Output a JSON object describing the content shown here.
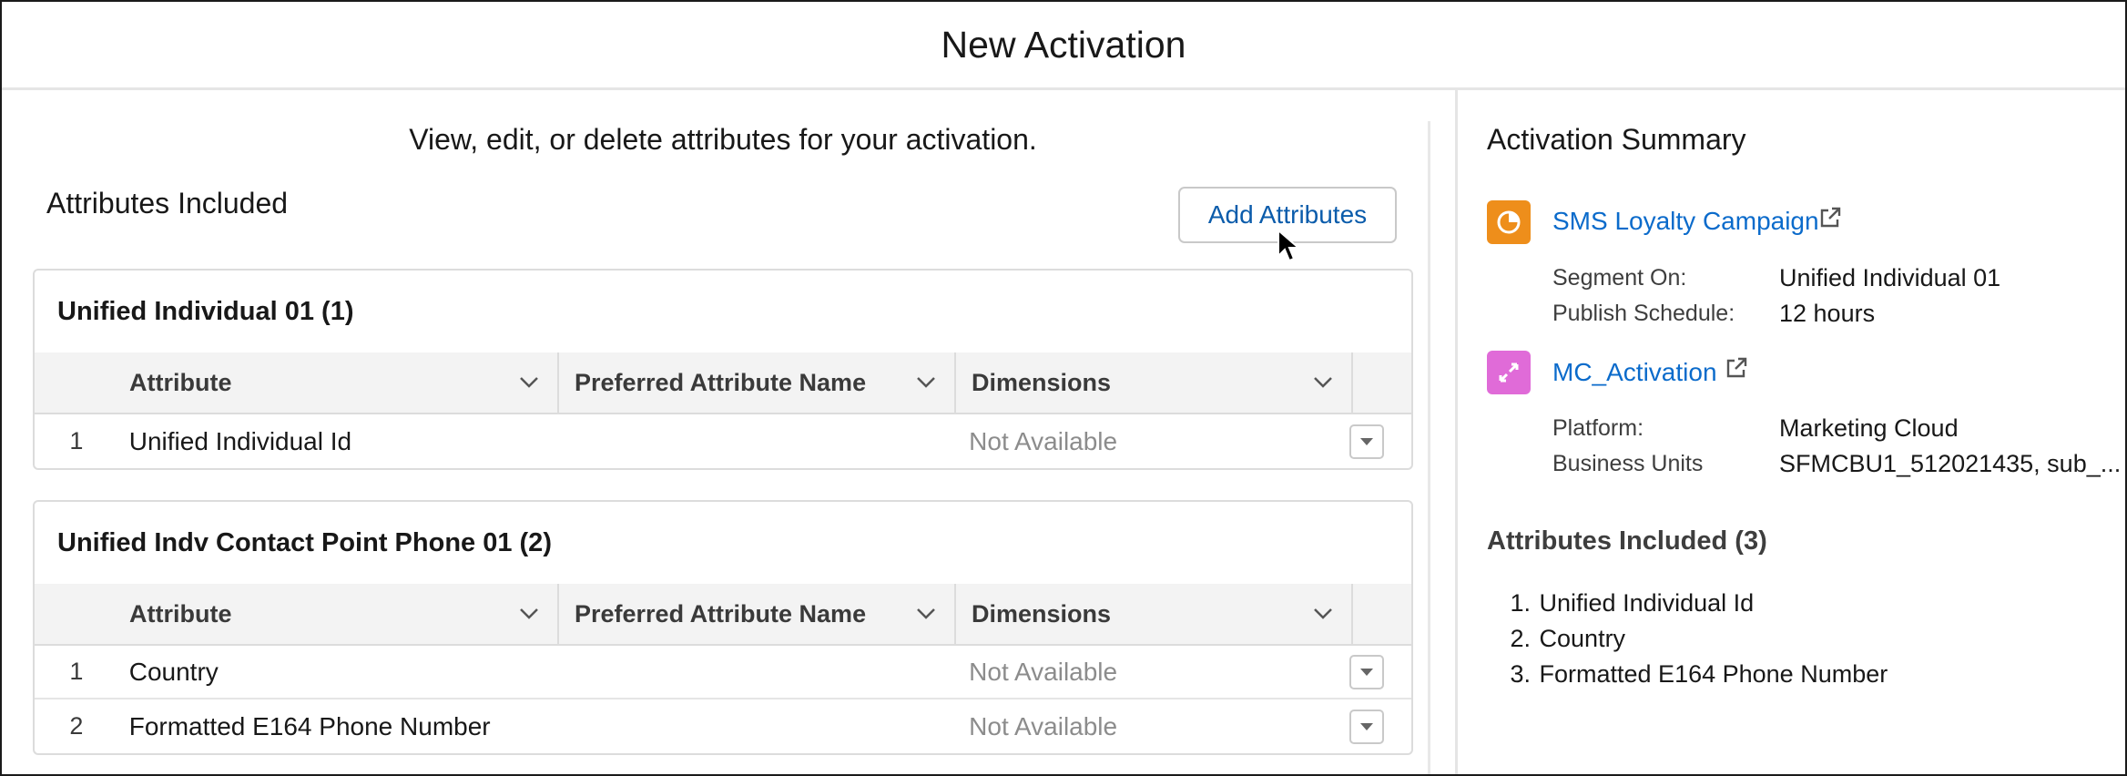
{
  "header": {
    "title": "New Activation"
  },
  "left": {
    "intro": "View, edit, or delete attributes for your activation.",
    "section_title": "Attributes Included",
    "add_button": "Add Attributes",
    "columns": {
      "attribute": "Attribute",
      "preferred": "Preferred Attribute Name",
      "dimensions": "Dimensions"
    },
    "groups": [
      {
        "title": "Unified Individual 01 (1)",
        "rows": [
          {
            "num": "1",
            "attribute": "Unified Individual Id",
            "preferred": "",
            "dimensions": "Not Available"
          }
        ]
      },
      {
        "title": "Unified Indv Contact Point Phone 01 (2)",
        "rows": [
          {
            "num": "1",
            "attribute": "Country",
            "preferred": "",
            "dimensions": "Not Available"
          },
          {
            "num": "2",
            "attribute": "Formatted E164 Phone Number",
            "preferred": "",
            "dimensions": "Not Available"
          }
        ]
      }
    ]
  },
  "summary": {
    "title": "Activation Summary",
    "segment": {
      "name": "SMS Loyalty Campaign",
      "icon": "segment-icon",
      "icon_color": "#ee8e1b",
      "segment_on_label": "Segment On:",
      "segment_on_value": "Unified Individual 01",
      "schedule_label": "Publish Schedule:",
      "schedule_value": "12 hours"
    },
    "target": {
      "name": "MC_Activation",
      "icon": "activation-target-icon",
      "icon_color": "#e06bd8",
      "platform_label": "Platform:",
      "platform_value": "Marketing Cloud",
      "bu_label": "Business Units",
      "bu_value": "SFMCBU1_512021435, sub_..."
    },
    "attributes_heading": "Attributes Included (3)",
    "attributes": [
      {
        "n": "1.",
        "name": "Unified Individual Id"
      },
      {
        "n": "2.",
        "name": "Country"
      },
      {
        "n": "3.",
        "name": "Formatted E164 Phone Number"
      }
    ]
  },
  "colors": {
    "link": "#0b6bcb",
    "button_text": "#0b5cab",
    "muted": "#8c8c8c"
  }
}
